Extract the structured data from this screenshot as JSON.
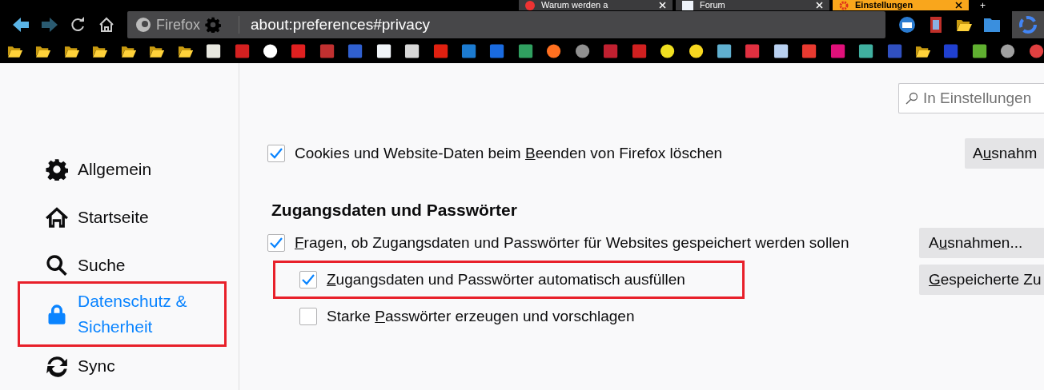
{
  "tabs": [
    {
      "label": "Warum werden a",
      "kind": "fox",
      "selected": false
    },
    {
      "label": "Forum",
      "kind": "site",
      "selected": false
    },
    {
      "label": "Einstellungen",
      "kind": "gear",
      "selected": true
    }
  ],
  "new_tab": "+",
  "toolbar": {
    "identity": "Firefox",
    "url": "about:preferences#privacy"
  },
  "bookmarks": [
    {
      "kind": "folder"
    },
    {
      "kind": "folder"
    },
    {
      "kind": "folder"
    },
    {
      "kind": "folder"
    },
    {
      "kind": "folder"
    },
    {
      "kind": "folder"
    },
    {
      "kind": "folder"
    },
    {
      "kind": "site",
      "color": "#e8e8e0"
    },
    {
      "kind": "site",
      "color": "#d42020"
    },
    {
      "kind": "round",
      "color": "#ffffff"
    },
    {
      "kind": "site",
      "color": "#e02020"
    },
    {
      "kind": "site",
      "color": "#c03030"
    },
    {
      "kind": "site",
      "color": "#3060d0"
    },
    {
      "kind": "site",
      "color": "#f0f4f8"
    },
    {
      "kind": "site",
      "color": "#d8d8d8"
    },
    {
      "kind": "site",
      "color": "#e02010"
    },
    {
      "kind": "site",
      "color": "#1c7bd0"
    },
    {
      "kind": "site",
      "color": "#1a6be0"
    },
    {
      "kind": "site",
      "color": "#30a060"
    },
    {
      "kind": "round",
      "color": "#ff7020"
    },
    {
      "kind": "round",
      "color": "#909090"
    },
    {
      "kind": "site",
      "color": "#c02030"
    },
    {
      "kind": "site",
      "color": "#d02020"
    },
    {
      "kind": "round",
      "color": "#f0e020"
    },
    {
      "kind": "round",
      "color": "#f8d820"
    },
    {
      "kind": "site",
      "color": "#60b0d0"
    },
    {
      "kind": "site",
      "color": "#e03040"
    },
    {
      "kind": "site",
      "color": "#b8d0f0"
    },
    {
      "kind": "site",
      "color": "#e83a30"
    },
    {
      "kind": "site",
      "color": "#e0107a"
    },
    {
      "kind": "site",
      "color": "#40b0a0"
    },
    {
      "kind": "site",
      "color": "#3050c0"
    },
    {
      "kind": "folder"
    },
    {
      "kind": "site",
      "color": "#2040d0"
    },
    {
      "kind": "site",
      "color": "#60b030"
    },
    {
      "kind": "round",
      "color": "#a0a0a0"
    },
    {
      "kind": "round",
      "color": "#e04040"
    }
  ],
  "sidebar": {
    "items": [
      {
        "label": "Allgemein",
        "kind": "gear",
        "selected": false,
        "highlighted": false
      },
      {
        "label": "Startseite",
        "kind": "home",
        "selected": false,
        "highlighted": false
      },
      {
        "label": "Suche",
        "kind": "search",
        "selected": false,
        "highlighted": false
      },
      {
        "label": "Datenschutz & Sicherheit",
        "kind": "lock",
        "selected": true,
        "highlighted": true
      },
      {
        "label": "Sync",
        "kind": "sync",
        "selected": false,
        "highlighted": false
      }
    ]
  },
  "search": {
    "placeholder": "In Einstellungen"
  },
  "cookies": {
    "label": {
      "before": "Cookies und Website-Daten beim ",
      "key": "B",
      "after": "eenden von Firefox löschen"
    },
    "checked": true,
    "button": {
      "before": "A",
      "key": "u",
      "after": "snahm"
    }
  },
  "logins": {
    "heading": "Zugangsdaten und Passwörter",
    "rows": [
      {
        "label": {
          "key": "F",
          "after": "ragen, ob Zugangsdaten und Passwörter für Websites gespeichert werden sollen"
        },
        "checked": true,
        "highlighted": false,
        "button": {
          "before": "A",
          "key": "u",
          "after": "snahmen..."
        },
        "children": [
          {
            "label": {
              "key": "Z",
              "after": "ugangsdaten und Passwörter automatisch ausfüllen"
            },
            "checked": true,
            "highlighted": true,
            "button": {
              "key": "G",
              "after": "espeicherte Zu"
            }
          },
          {
            "label": {
              "before": "Starke ",
              "key": "P",
              "after": "asswörter erzeugen und vorschlagen"
            },
            "checked": false,
            "highlighted": false
          }
        ]
      }
    ]
  }
}
